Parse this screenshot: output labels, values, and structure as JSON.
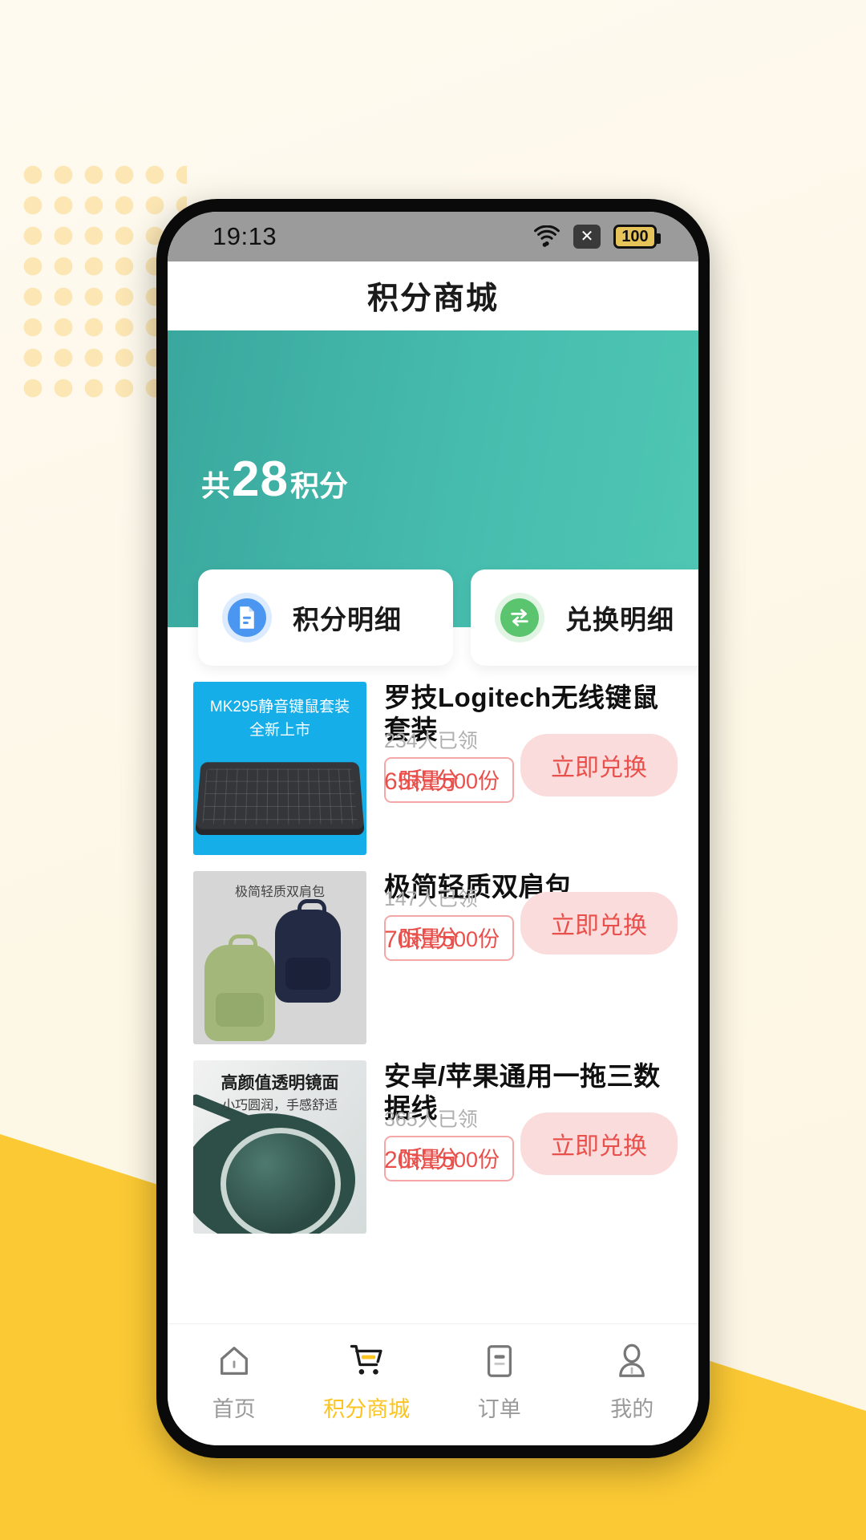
{
  "statusbar": {
    "time": "19:13",
    "battery_level": "100",
    "icons": [
      "wifi-icon",
      "signal-off-icon",
      "battery-icon"
    ]
  },
  "header": {
    "title": "积分商城"
  },
  "hero": {
    "points_prefix": "共",
    "points_value": "28",
    "points_suffix": "积分",
    "background_color": "#46BCAE"
  },
  "tabcards": [
    {
      "label": "积分明细",
      "icon": "document-icon",
      "color": "#4A96F0"
    },
    {
      "label": "兑换明细",
      "icon": "exchange-arrows-icon",
      "color": "#5BC46F"
    }
  ],
  "products": [
    {
      "title": "罗技Logitech无线键鼠套装",
      "limit": "限量500份",
      "claimed": "234人已领",
      "price": "65积分",
      "button": "立即兑换",
      "image_caption_line1": "MK295静音键鼠套装",
      "image_caption_line2": "全新上市"
    },
    {
      "title": "极简轻质双肩包",
      "limit": "限量500份",
      "claimed": "147人已领",
      "price": "70积分",
      "button": "立即兑换",
      "image_caption_line1": "极简轻质双肩包",
      "image_caption_line2": ""
    },
    {
      "title": "安卓/苹果通用一拖三数据线",
      "limit": "限量500份",
      "claimed": "365人已领",
      "price": "20积分",
      "button": "立即兑换",
      "image_caption_line1": "高颜值透明镜面",
      "image_caption_line2": "小巧圆润，手感舒适"
    }
  ],
  "tabbar": {
    "active_color": "#FBC420",
    "items": [
      {
        "label": "首页",
        "icon": "home-icon",
        "active": false
      },
      {
        "label": "积分商城",
        "icon": "cart-icon",
        "active": true
      },
      {
        "label": "订单",
        "icon": "order-icon",
        "active": false
      },
      {
        "label": "我的",
        "icon": "person-icon",
        "active": false
      }
    ]
  }
}
